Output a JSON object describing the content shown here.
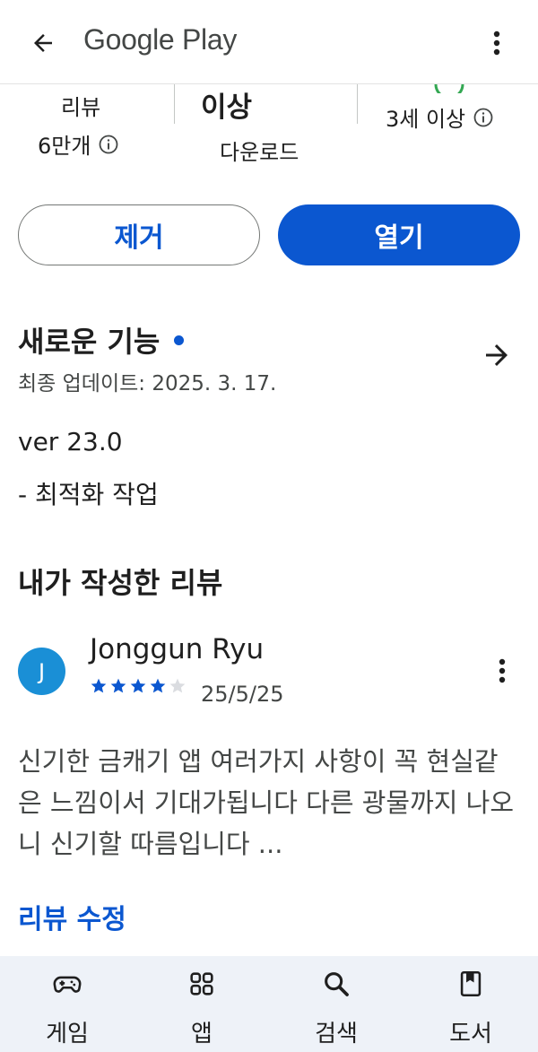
{
  "appbar": {
    "brand": "Google Play",
    "back_icon": "arrow-back-icon",
    "more_icon": "more-vert-icon"
  },
  "stats": {
    "reviews_label": "리뷰",
    "reviews_count": "6만개",
    "downloads_value": "이상",
    "downloads_label": "다운로드",
    "age_rating": "3세 이상"
  },
  "actions": {
    "remove_label": "제거",
    "open_label": "열기"
  },
  "whats_new": {
    "title": "새로운 기능",
    "last_updated": "최종 업데이트: 2025. 3. 17.",
    "version": "ver 23.0",
    "note": "- 최적화 작업"
  },
  "my_review": {
    "section_title": "내가 작성한 리뷰",
    "avatar_initial": "J",
    "reviewer": "Jonggun Ryu",
    "rating": 4,
    "rating_max": 5,
    "date": "25/5/25",
    "body": "신기한 금캐기 앱 여러가지 사항이 꼭 현실같은 느낌이서 기대가됩니다 다른 광물까지 나오니 신기할 따름입니다 ...",
    "edit_label": "리뷰 수정"
  },
  "bottom_nav": {
    "items": [
      {
        "label": "게임",
        "icon": "gamepad-icon"
      },
      {
        "label": "앱",
        "icon": "apps-grid-icon"
      },
      {
        "label": "검색",
        "icon": "search-icon"
      },
      {
        "label": "도서",
        "icon": "book-icon"
      }
    ]
  },
  "colors": {
    "accent": "#0b57d0",
    "avatar": "#1a8fd6",
    "nav_background": "#eef2f8",
    "rating_green": "#34a853"
  }
}
